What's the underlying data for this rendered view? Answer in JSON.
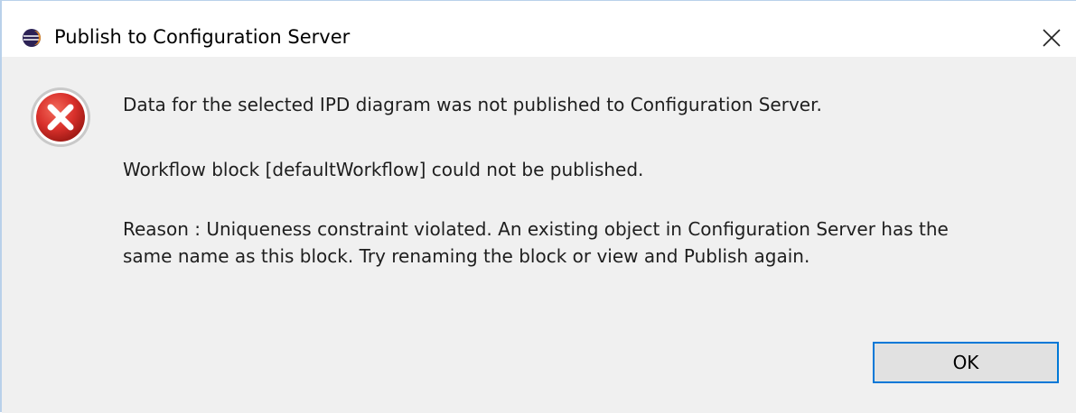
{
  "window": {
    "title": "Publish to Configuration Server",
    "app_icon": "eclipse-icon",
    "close_icon": "close-icon"
  },
  "message": {
    "icon": "error-icon",
    "line1": "Data for the selected IPD diagram was not published to Configuration Server.",
    "line2": "Workflow block [defaultWorkflow] could not be published.",
    "line3a": "Reason : Uniqueness constraint violated. An existing object in Configuration Server has the",
    "line3b": "same name as this block. Try renaming the block or view and Publish again."
  },
  "buttons": {
    "ok_label": "OK"
  },
  "colors": {
    "titlebar_bg": "#ffffff",
    "content_bg": "#f0f0f0",
    "accent_border": "#0078d7",
    "error_red": "#d32f2f"
  }
}
